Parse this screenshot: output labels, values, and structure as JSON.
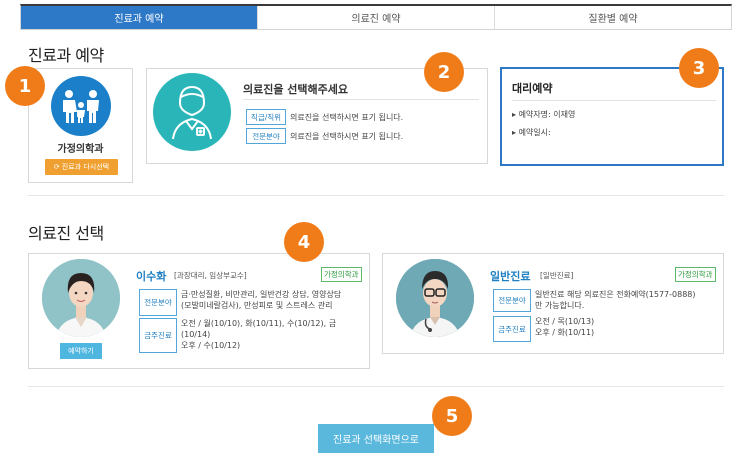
{
  "tabs": [
    {
      "label": "진료과 예약",
      "active": true
    },
    {
      "label": "의료진 예약",
      "active": false
    },
    {
      "label": "질환별 예약",
      "active": false
    }
  ],
  "dept_section": {
    "title": "진료과 예약",
    "department": {
      "name": "가정의학과",
      "icon": "family-icon",
      "reselect_label": "진료과 다시선택"
    },
    "doctor_select": {
      "title": "의료진을 선택해주세요",
      "rows": [
        {
          "badge": "직급/직위",
          "text": "의료진을 선택하시면 표기 됩니다."
        },
        {
          "badge": "전문분야",
          "text": "의료진을 선택하시면 표기 됩니다."
        }
      ]
    },
    "proxy": {
      "title": "대리예약",
      "reserver_label": "예약자명:",
      "reserver_name": "이재영",
      "date_label": "예약일시:"
    }
  },
  "doctor_section": {
    "title": "의료진 선택",
    "doctors": [
      {
        "name": "이수화",
        "rank": "[과장대리, 임상부교수]",
        "dept": "가정의학과",
        "specialty_label": "전문분야",
        "specialty_lines": [
          "금·만성질환, 비만관리, 일반건강 상담, 영양상담",
          "(모발미네랄검사), 만성피로 및 스트레스 관리"
        ],
        "schedule_label": "금주진료",
        "schedule_lines": [
          "오전 / 월(10/10), 화(10/11), 수(10/12), 금",
          "(10/14)",
          "오후 / 수(10/12)"
        ],
        "reserve_label": "예약하기"
      },
      {
        "name": "일반진료",
        "rank": "[일반진료]",
        "dept": "가정의학과",
        "specialty_label": "전문분야",
        "specialty_lines": [
          "일반진료 해당 의료진은 전화예약(1577-0888)",
          "만 가능합니다."
        ],
        "schedule_label": "금주진료",
        "schedule_lines": [
          "오전 / 목(10/13)",
          "오후 / 화(10/11)"
        ]
      }
    ]
  },
  "back_button": "진료과 선택화면으로",
  "markers": [
    "1",
    "2",
    "3",
    "4",
    "5"
  ],
  "colors": {
    "primary": "#2e78c8",
    "accent": "#f07c19",
    "teal": "#2ab5b8",
    "button": "#5ab8dc",
    "dept_tag": "#2a9a3c"
  }
}
